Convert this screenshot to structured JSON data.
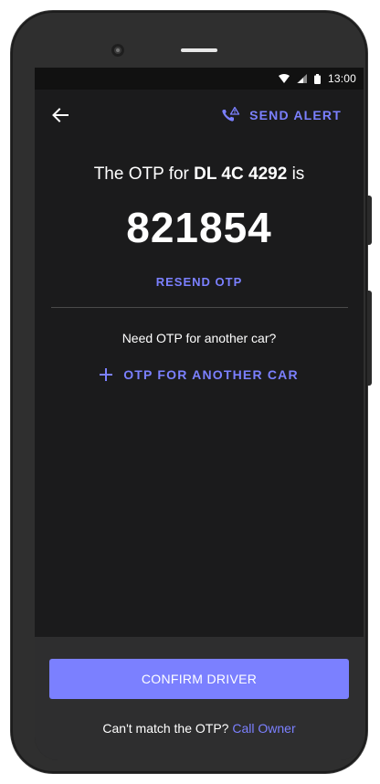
{
  "status_bar": {
    "time": "13:00",
    "icons": [
      "wifi-icon",
      "signal-icon",
      "battery-icon"
    ]
  },
  "appbar": {
    "back_icon": "arrow-left-icon",
    "send_alert_icon": "phone-alert-icon",
    "send_alert_label": "SEND ALERT"
  },
  "otp": {
    "title_prefix": "The OTP for",
    "vehicle_number": "DL 4C 4292",
    "title_suffix": "is",
    "code": "821854",
    "resend_label": "RESEND OTP"
  },
  "another_car": {
    "prompt": "Need OTP for another car?",
    "icon": "plus-icon",
    "label": "OTP FOR ANOTHER CAR"
  },
  "footer": {
    "confirm_label": "CONFIRM DRIVER",
    "cant_match_text": "Can't match the OTP?",
    "call_owner_label": "Call Owner"
  },
  "colors": {
    "accent": "#7b80ff",
    "screen_bg": "#1b1b1c",
    "panel_bg": "#2e2e2f",
    "text": "#ffffff"
  }
}
